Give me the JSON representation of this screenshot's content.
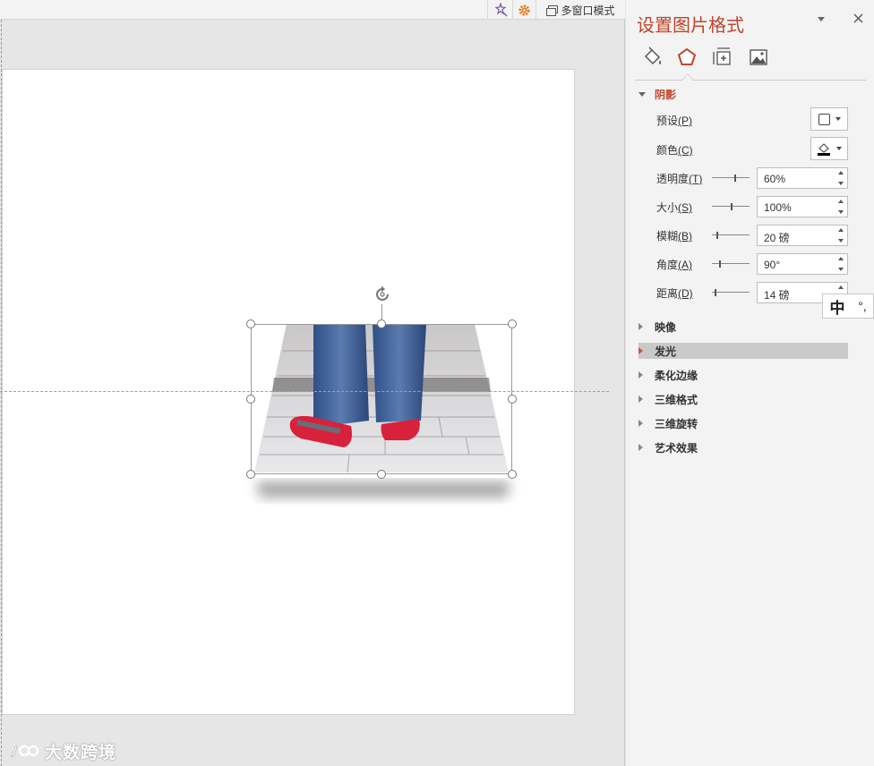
{
  "toolbar": {
    "multi_window_label": "多窗口模式"
  },
  "watermark": {
    "text": "大数跨境"
  },
  "pane": {
    "title": "设置图片格式",
    "tabs": [
      {
        "name": "fill-line",
        "icon": "paint-bucket-icon"
      },
      {
        "name": "effects",
        "icon": "pentagon-icon",
        "active": true
      },
      {
        "name": "size-properties",
        "icon": "size-position-icon"
      },
      {
        "name": "picture",
        "icon": "image-icon"
      }
    ],
    "shadow": {
      "title": "阴影",
      "preset_label": "预设",
      "preset_key": "(P)",
      "color_label": "颜色",
      "color_key": "(C)",
      "transparency_label": "透明度",
      "transparency_key": "(T)",
      "transparency_value": "60%",
      "size_label": "大小",
      "size_key": "(S)",
      "size_value": "100%",
      "blur_label": "模糊",
      "blur_key": "(B)",
      "blur_value": "20 磅",
      "angle_label": "角度",
      "angle_key": "(A)",
      "angle_value": "90°",
      "distance_label": "距离",
      "distance_key": "(D)",
      "distance_value": "14 磅"
    },
    "sections": {
      "reflection": "映像",
      "glow": "发光",
      "soft_edges": "柔化边缘",
      "format_3d": "三维格式",
      "rotation_3d": "三维旋转",
      "artistic": "艺术效果"
    }
  },
  "ime": {
    "mode": "中",
    "punct": "°,"
  },
  "colors": {
    "accent": "#c0442b",
    "pane_bg": "#f3f3f3",
    "workspace_bg": "#e6e6e6"
  }
}
